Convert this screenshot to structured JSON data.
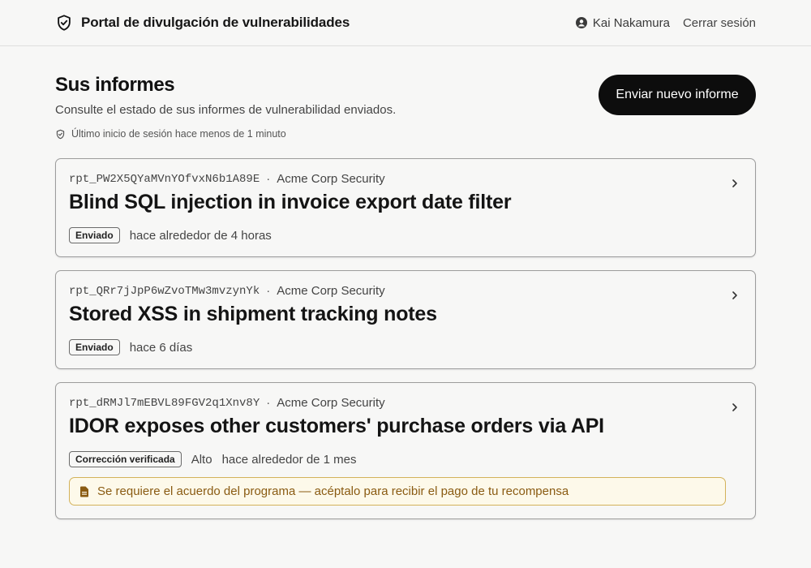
{
  "header": {
    "title": "Portal de divulgación de vulnerabilidades",
    "user_name": "Kai Nakamura",
    "logout_label": "Cerrar sesión"
  },
  "page": {
    "title": "Sus informes",
    "subtitle": "Consulte el estado de sus informes de vulnerabilidad enviados.",
    "last_login": "Último inicio de sesión hace menos de 1 minuto",
    "new_report_label": "Enviar nuevo informe"
  },
  "reports": [
    {
      "id": "rpt_PW2X5QYaMVnYOfvxN6b1A89E",
      "org": "Acme Corp Security",
      "title": "Blind SQL injection in invoice export date filter",
      "status": "Enviado",
      "severity": "",
      "time": "hace alrededor de 4 horas"
    },
    {
      "id": "rpt_QRr7jJpP6wZvoTMw3mvzynYk",
      "org": "Acme Corp Security",
      "title": "Stored XSS in shipment tracking notes",
      "status": "Enviado",
      "severity": "",
      "time": "hace 6 días"
    },
    {
      "id": "rpt_dRMJl7mEBVL89FGV2q1Xnv8Y",
      "org": "Acme Corp Security",
      "title": "IDOR exposes other customers' purchase orders via API",
      "status": "Corrección verificada",
      "severity": "Alto",
      "time": "hace alrededor de 1 mes",
      "notice": "Se requiere el acuerdo del programa — acéptalo para recibir el pago de tu recompensa"
    }
  ],
  "separator": "·",
  "icons": {
    "brand": "shield-check-icon",
    "user": "user-circle-icon",
    "last_login": "shield-check-icon",
    "chevron": "chevron-right-icon",
    "notice": "document-icon"
  },
  "colors": {
    "primary_button": "#0d0d0d",
    "notice_border": "#d3b25a",
    "notice_bg": "#fdf9ea",
    "notice_text": "#8a5b12"
  }
}
